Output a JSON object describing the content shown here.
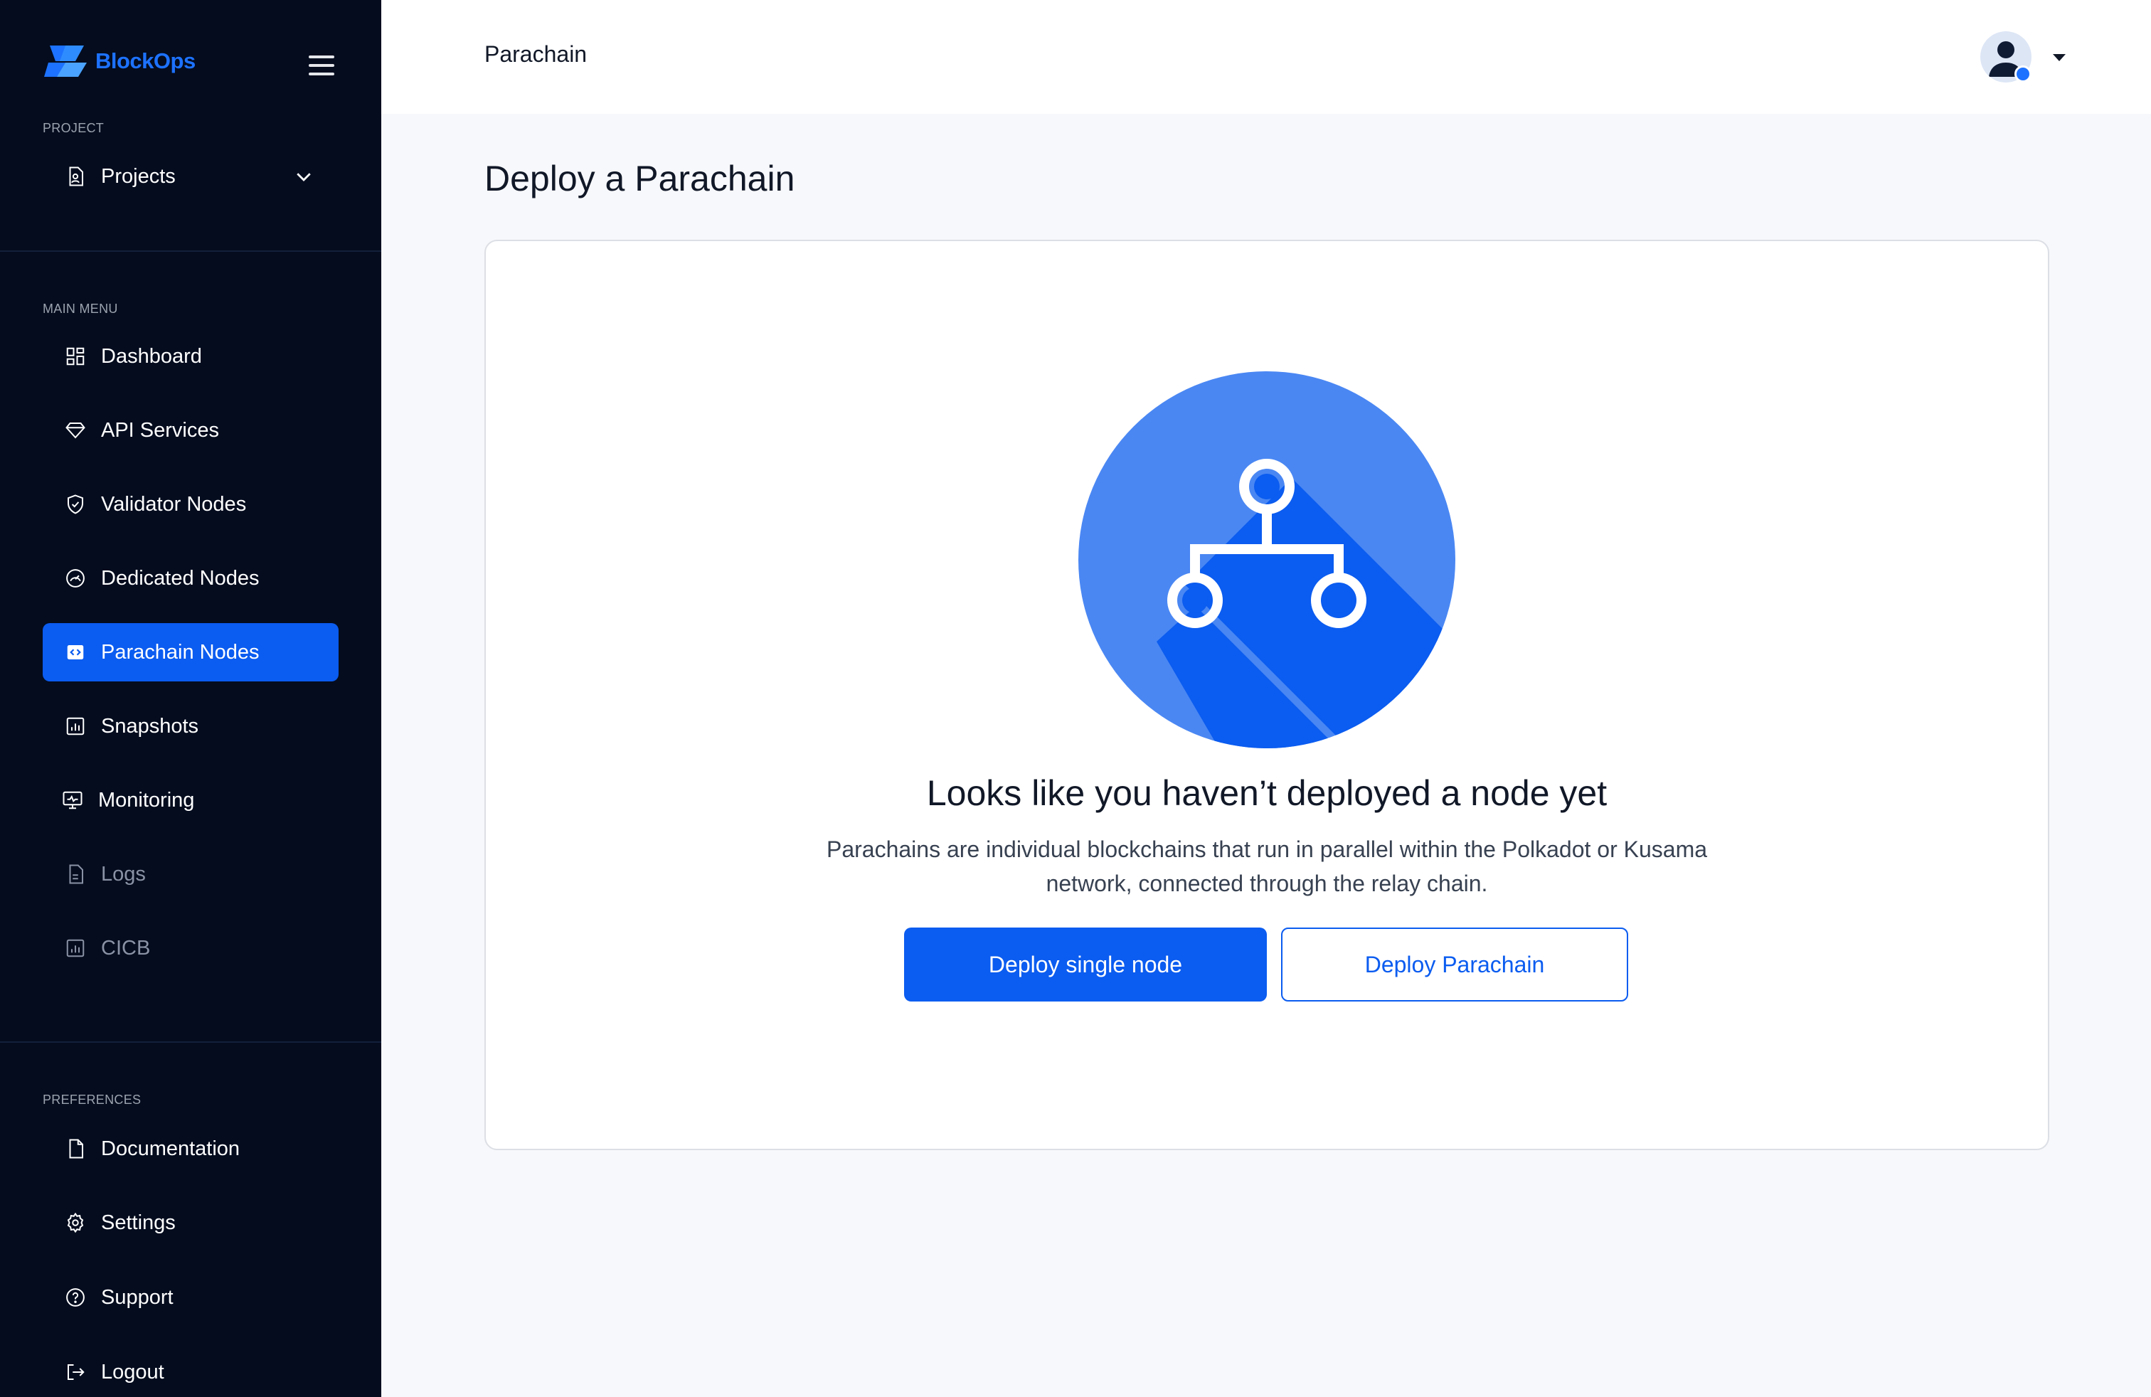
{
  "brand": {
    "name": "BlockOps",
    "color": "#1d72ff"
  },
  "sidebar": {
    "project_label": "PROJECT",
    "projects_item": {
      "label": "Projects",
      "icon": "project-icon"
    },
    "main_menu_label": "MAIN MENU",
    "items": [
      {
        "label": "Dashboard",
        "icon": "dashboard-icon",
        "active": false
      },
      {
        "label": "API Services",
        "icon": "diamond-icon",
        "active": false
      },
      {
        "label": "Validator Nodes",
        "icon": "shield-icon",
        "active": false
      },
      {
        "label": "Dedicated Nodes",
        "icon": "gauge-icon",
        "active": false
      },
      {
        "label": "Parachain Nodes",
        "icon": "code-icon",
        "active": true
      },
      {
        "label": "Snapshots",
        "icon": "chart-icon",
        "active": false
      },
      {
        "label": "Monitoring",
        "icon": "monitor-icon",
        "active": false
      },
      {
        "label": "Logs",
        "icon": "file-icon",
        "active": false,
        "disabled": true
      },
      {
        "label": "CICB",
        "icon": "chart-icon",
        "active": false,
        "disabled": true
      }
    ],
    "preferences_label": "PREFERENCES",
    "preferences": [
      {
        "label": "Documentation",
        "icon": "document-icon"
      },
      {
        "label": "Settings",
        "icon": "gear-icon"
      },
      {
        "label": "Support",
        "icon": "help-icon"
      },
      {
        "label": "Logout",
        "icon": "logout-icon"
      }
    ]
  },
  "header": {
    "title": "Parachain"
  },
  "main": {
    "page_title": "Deploy a Parachain",
    "empty_state": {
      "title": "Looks like you haven’t deployed a node yet",
      "description": "Parachains are individual blockchains that run in parallel within the Polkadot or Kusama network, connected through the relay chain.",
      "primary_button": "Deploy single node",
      "secondary_button": "Deploy Parachain",
      "illustration_icon": "network-tree-icon"
    }
  },
  "colors": {
    "accent": "#0b5cf0",
    "sidebar_bg": "#040c1e",
    "page_bg": "#f7f8fb"
  }
}
